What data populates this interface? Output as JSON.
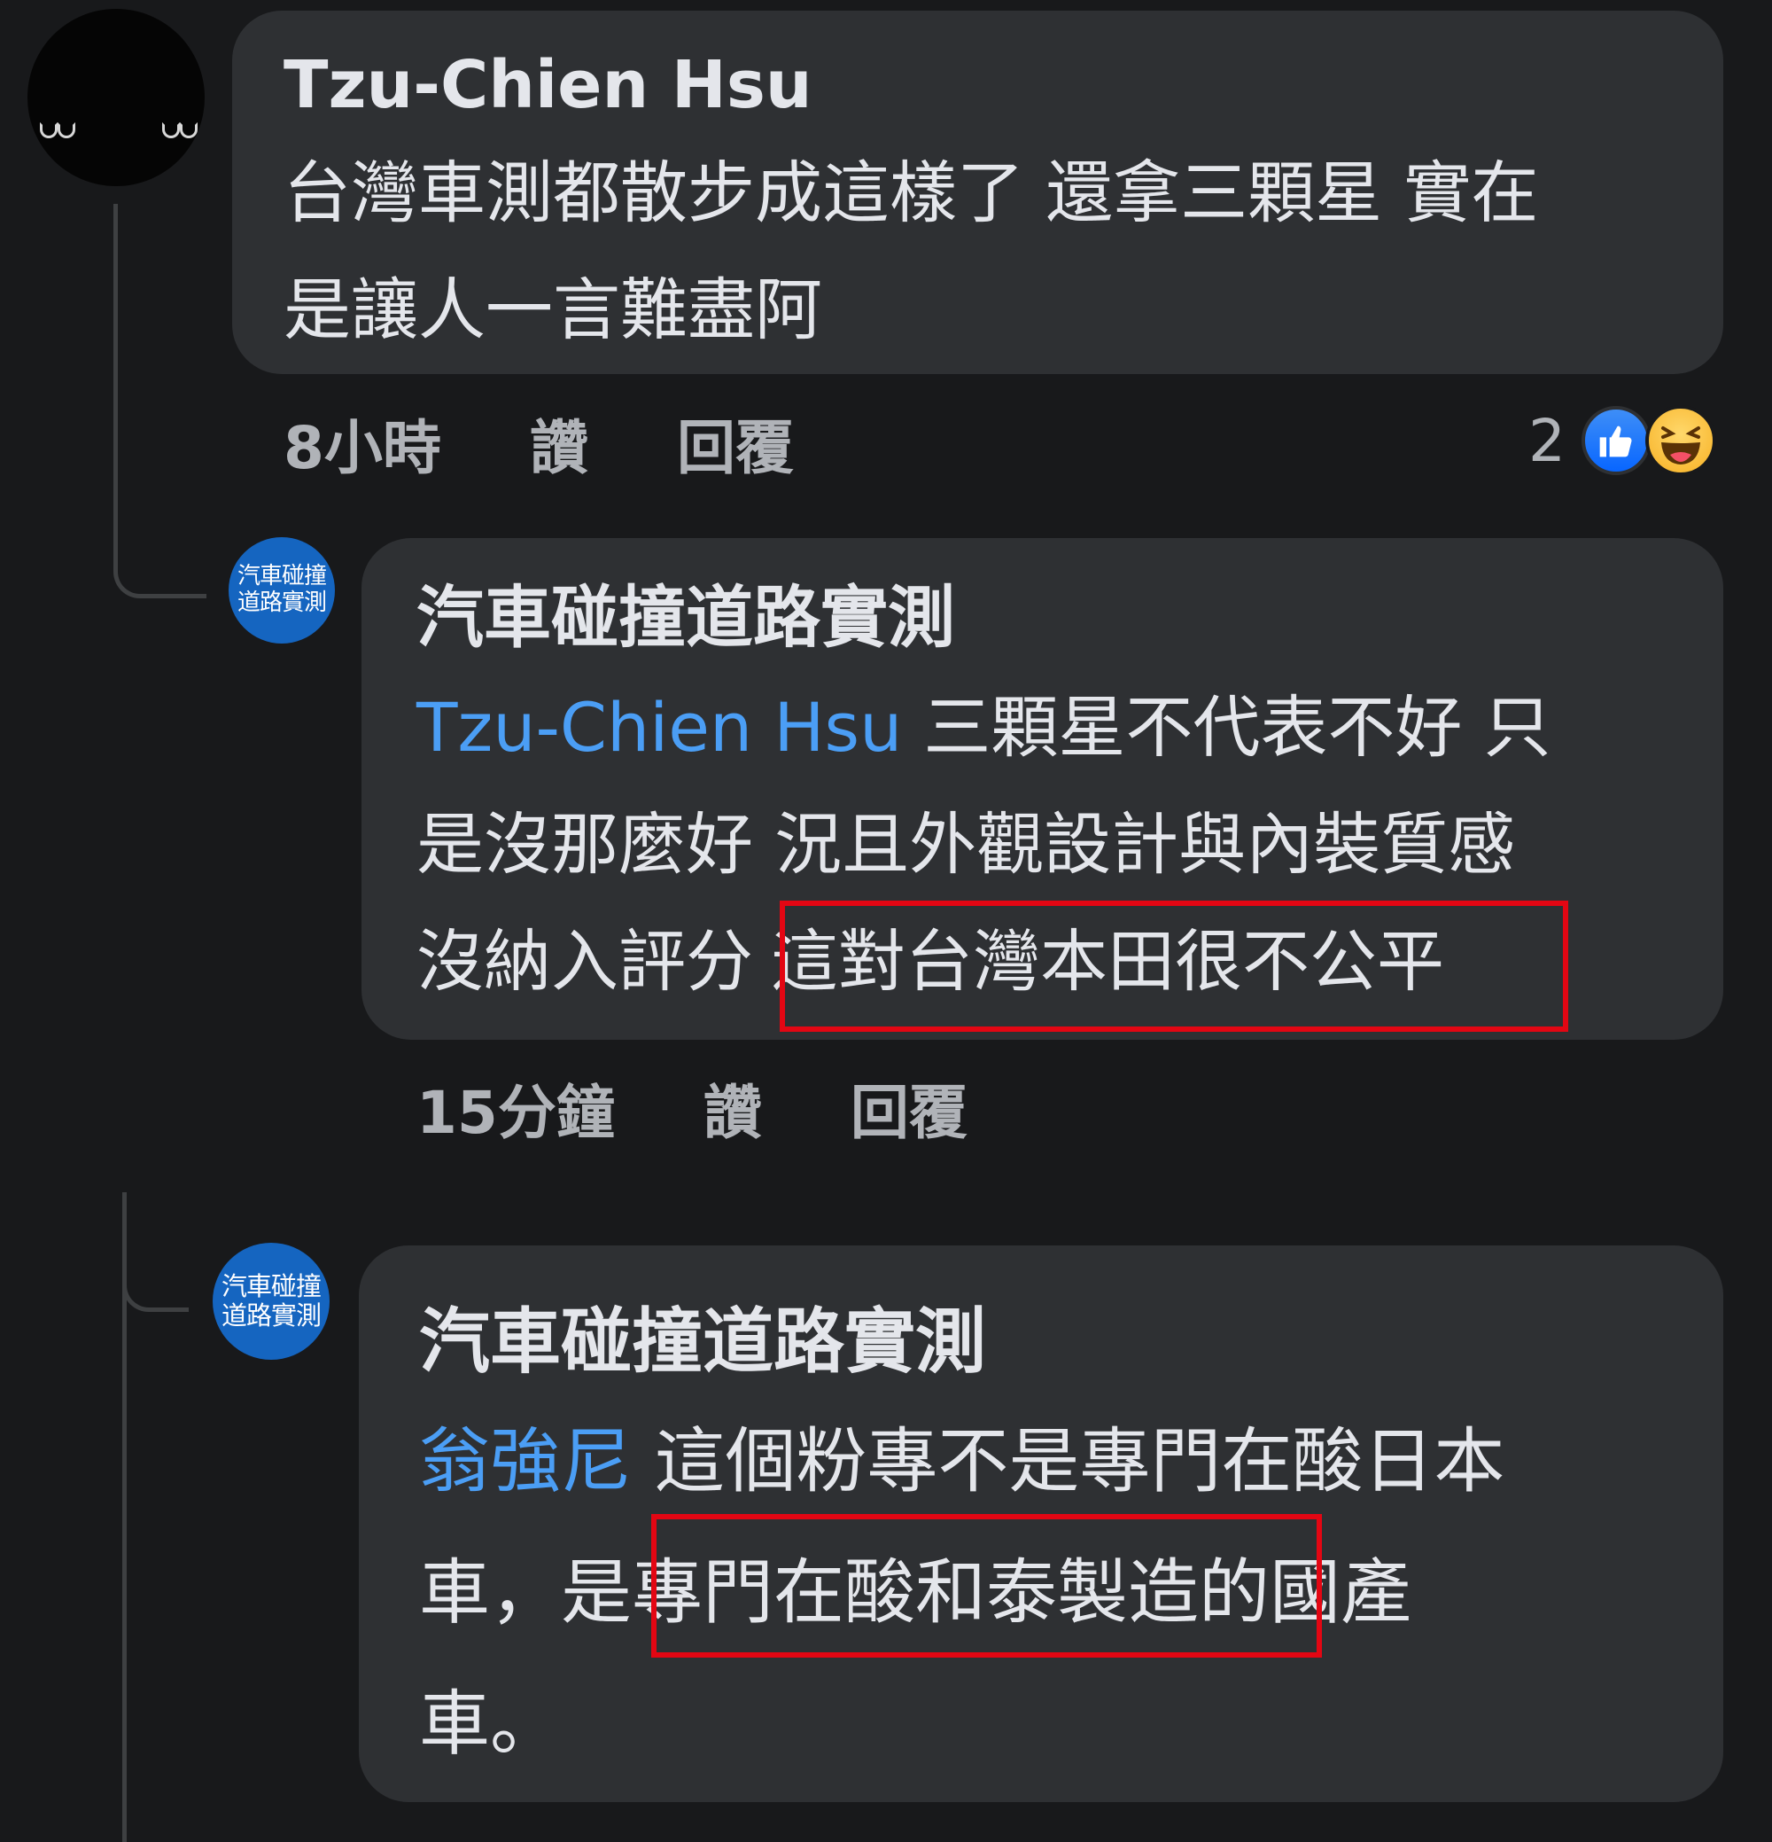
{
  "comments": [
    {
      "author": "Tzu-Chien Hsu",
      "text": "台灣車測都散步成這樣了 還拿三顆星 實在\n是讓人一言難盡阿",
      "time": "8小時",
      "like_label": "讚",
      "reply_label": "回覆",
      "reaction_count": "2",
      "reaction_icons": [
        "like-icon",
        "haha-icon"
      ]
    },
    {
      "author": "汽車碰撞道路實測",
      "avatar_line1": "汽車碰撞",
      "avatar_line2": "道路實測",
      "mention": "Tzu-Chien Hsu",
      "text_after_mention": " 三顆星不代表不好 只",
      "text_lines": [
        "是沒那麼好 況且外觀設計與內裝質感"
      ],
      "text_before_highlight": "沒納入評分",
      "highlight_text": "這對台灣本田很不公平",
      "time": "15分鐘",
      "like_label": "讚",
      "reply_label": "回覆"
    },
    {
      "author": "汽車碰撞道路實測",
      "avatar_line1": "汽車碰撞",
      "avatar_line2": "道路實測",
      "mention": "翁強尼",
      "text_after_mention": " 這個粉專不是專門在酸日本",
      "text_before_highlight": "車，是",
      "highlight_text": "專門在酸和泰製造",
      "text_after_highlight": "的國產",
      "text_last_line": "車。"
    }
  ],
  "colors": {
    "background": "#18191b",
    "bubble": "#2e3033",
    "text": "#e4e6eb",
    "secondary_text": "#b0b3b8",
    "mention": "#4b9ef5",
    "highlight_box": "#e30613",
    "avatar_blue": "#1565c0"
  }
}
